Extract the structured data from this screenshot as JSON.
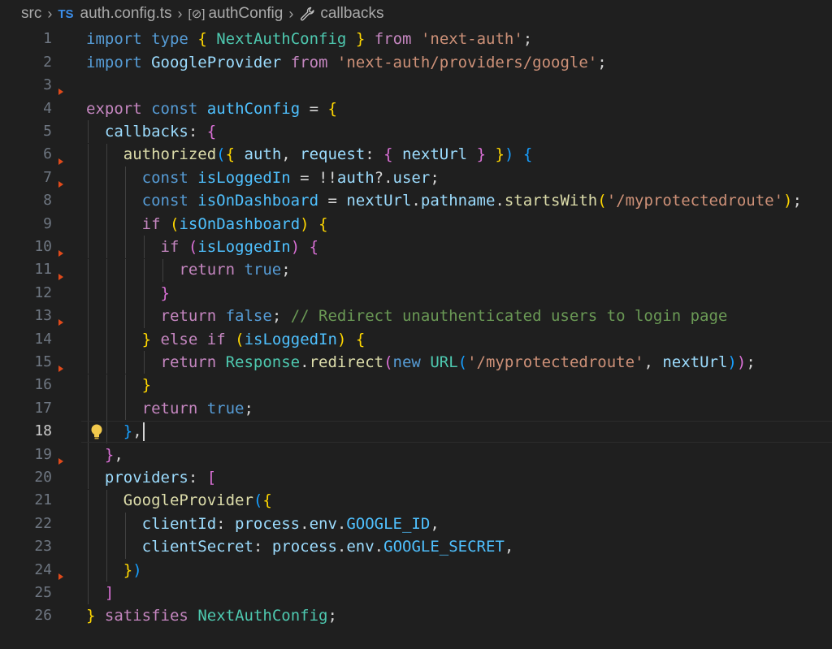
{
  "breadcrumb": {
    "folder": "src",
    "file_icon": "TS",
    "file": "auth.config.ts",
    "symbol_icon": "[⊘]",
    "symbol": "authConfig",
    "member": "callbacks"
  },
  "editor": {
    "language": "typescript",
    "current_line": 18,
    "line_numbers": [
      "1",
      "2",
      "3",
      "4",
      "5",
      "6",
      "7",
      "8",
      "9",
      "10",
      "11",
      "12",
      "13",
      "14",
      "15",
      "16",
      "17",
      "18",
      "19",
      "20",
      "21",
      "22",
      "23",
      "24",
      "25",
      "26"
    ],
    "lines": [
      [
        [
          "kw",
          "import"
        ],
        [
          "pl",
          " "
        ],
        [
          "kw",
          "type"
        ],
        [
          "pl",
          " "
        ],
        [
          "b1",
          "{"
        ],
        [
          "pl",
          " "
        ],
        [
          "type",
          "NextAuthConfig"
        ],
        [
          "pl",
          " "
        ],
        [
          "b1",
          "}"
        ],
        [
          "pl",
          " "
        ],
        [
          "ctl",
          "from"
        ],
        [
          "pl",
          " "
        ],
        [
          "str",
          "'next-auth'"
        ],
        [
          "pl",
          ";"
        ]
      ],
      [
        [
          "kw",
          "import"
        ],
        [
          "pl",
          " "
        ],
        [
          "var",
          "GoogleProvider"
        ],
        [
          "pl",
          " "
        ],
        [
          "ctl",
          "from"
        ],
        [
          "pl",
          " "
        ],
        [
          "str",
          "'next-auth/providers/google'"
        ],
        [
          "pl",
          ";"
        ]
      ],
      [],
      [
        [
          "ctl",
          "export"
        ],
        [
          "pl",
          " "
        ],
        [
          "kw",
          "const"
        ],
        [
          "pl",
          " "
        ],
        [
          "const",
          "authConfig"
        ],
        [
          "pl",
          " = "
        ],
        [
          "b1",
          "{"
        ]
      ],
      [
        [
          "pl",
          "  "
        ],
        [
          "var",
          "callbacks"
        ],
        [
          "pl",
          ": "
        ],
        [
          "b2",
          "{"
        ]
      ],
      [
        [
          "pl",
          "    "
        ],
        [
          "fn",
          "authorized"
        ],
        [
          "b3",
          "("
        ],
        [
          "b1",
          "{"
        ],
        [
          "pl",
          " "
        ],
        [
          "var",
          "auth"
        ],
        [
          "pl",
          ", "
        ],
        [
          "var",
          "request"
        ],
        [
          "pl",
          ": "
        ],
        [
          "b2",
          "{"
        ],
        [
          "pl",
          " "
        ],
        [
          "var",
          "nextUrl"
        ],
        [
          "pl",
          " "
        ],
        [
          "b2",
          "}"
        ],
        [
          "pl",
          " "
        ],
        [
          "b1",
          "}"
        ],
        [
          "b3",
          ")"
        ],
        [
          "pl",
          " "
        ],
        [
          "b3",
          "{"
        ]
      ],
      [
        [
          "pl",
          "      "
        ],
        [
          "kw",
          "const"
        ],
        [
          "pl",
          " "
        ],
        [
          "const",
          "isLoggedIn"
        ],
        [
          "pl",
          " = !!"
        ],
        [
          "var",
          "auth"
        ],
        [
          "pl",
          "?."
        ],
        [
          "var",
          "user"
        ],
        [
          "pl",
          ";"
        ]
      ],
      [
        [
          "pl",
          "      "
        ],
        [
          "kw",
          "const"
        ],
        [
          "pl",
          " "
        ],
        [
          "const",
          "isOnDashboard"
        ],
        [
          "pl",
          " = "
        ],
        [
          "var",
          "nextUrl"
        ],
        [
          "pl",
          "."
        ],
        [
          "var",
          "pathname"
        ],
        [
          "pl",
          "."
        ],
        [
          "fn",
          "startsWith"
        ],
        [
          "b1",
          "("
        ],
        [
          "str",
          "'/myprotectedroute'"
        ],
        [
          "b1",
          ")"
        ],
        [
          "pl",
          ";"
        ]
      ],
      [
        [
          "pl",
          "      "
        ],
        [
          "ctl",
          "if"
        ],
        [
          "pl",
          " "
        ],
        [
          "b1",
          "("
        ],
        [
          "const",
          "isOnDashboard"
        ],
        [
          "b1",
          ")"
        ],
        [
          "pl",
          " "
        ],
        [
          "b1",
          "{"
        ]
      ],
      [
        [
          "pl",
          "        "
        ],
        [
          "ctl",
          "if"
        ],
        [
          "pl",
          " "
        ],
        [
          "b2",
          "("
        ],
        [
          "const",
          "isLoggedIn"
        ],
        [
          "b2",
          ")"
        ],
        [
          "pl",
          " "
        ],
        [
          "b2",
          "{"
        ]
      ],
      [
        [
          "pl",
          "          "
        ],
        [
          "ctl",
          "return"
        ],
        [
          "pl",
          " "
        ],
        [
          "bool",
          "true"
        ],
        [
          "pl",
          ";"
        ]
      ],
      [
        [
          "pl",
          "        "
        ],
        [
          "b2",
          "}"
        ]
      ],
      [
        [
          "pl",
          "        "
        ],
        [
          "ctl",
          "return"
        ],
        [
          "pl",
          " "
        ],
        [
          "bool",
          "false"
        ],
        [
          "pl",
          "; "
        ],
        [
          "cmt",
          "// Redirect unauthenticated users to login page"
        ]
      ],
      [
        [
          "pl",
          "      "
        ],
        [
          "b1",
          "}"
        ],
        [
          "pl",
          " "
        ],
        [
          "ctl",
          "else"
        ],
        [
          "pl",
          " "
        ],
        [
          "ctl",
          "if"
        ],
        [
          "pl",
          " "
        ],
        [
          "b1",
          "("
        ],
        [
          "const",
          "isLoggedIn"
        ],
        [
          "b1",
          ")"
        ],
        [
          "pl",
          " "
        ],
        [
          "b1",
          "{"
        ]
      ],
      [
        [
          "pl",
          "        "
        ],
        [
          "ctl",
          "return"
        ],
        [
          "pl",
          " "
        ],
        [
          "type",
          "Response"
        ],
        [
          "pl",
          "."
        ],
        [
          "fn",
          "redirect"
        ],
        [
          "b2",
          "("
        ],
        [
          "kw",
          "new"
        ],
        [
          "pl",
          " "
        ],
        [
          "type",
          "URL"
        ],
        [
          "b3",
          "("
        ],
        [
          "str",
          "'/myprotectedroute'"
        ],
        [
          "pl",
          ", "
        ],
        [
          "var",
          "nextUrl"
        ],
        [
          "b3",
          ")"
        ],
        [
          "b2",
          ")"
        ],
        [
          "pl",
          ";"
        ]
      ],
      [
        [
          "pl",
          "      "
        ],
        [
          "b1",
          "}"
        ]
      ],
      [
        [
          "pl",
          "      "
        ],
        [
          "ctl",
          "return"
        ],
        [
          "pl",
          " "
        ],
        [
          "bool",
          "true"
        ],
        [
          "pl",
          ";"
        ]
      ],
      [
        [
          "pl",
          "    "
        ],
        [
          "b3",
          "}"
        ],
        [
          "pl",
          ","
        ]
      ],
      [
        [
          "pl",
          "  "
        ],
        [
          "b2",
          "}"
        ],
        [
          "pl",
          ","
        ]
      ],
      [
        [
          "pl",
          "  "
        ],
        [
          "var",
          "providers"
        ],
        [
          "pl",
          ": "
        ],
        [
          "b2",
          "["
        ]
      ],
      [
        [
          "pl",
          "    "
        ],
        [
          "fn",
          "GoogleProvider"
        ],
        [
          "b3",
          "("
        ],
        [
          "b1",
          "{"
        ]
      ],
      [
        [
          "pl",
          "      "
        ],
        [
          "var",
          "clientId"
        ],
        [
          "pl",
          ": "
        ],
        [
          "var",
          "process"
        ],
        [
          "pl",
          "."
        ],
        [
          "var",
          "env"
        ],
        [
          "pl",
          "."
        ],
        [
          "const",
          "GOOGLE_ID"
        ],
        [
          "pl",
          ","
        ]
      ],
      [
        [
          "pl",
          "      "
        ],
        [
          "var",
          "clientSecret"
        ],
        [
          "pl",
          ": "
        ],
        [
          "var",
          "process"
        ],
        [
          "pl",
          "."
        ],
        [
          "var",
          "env"
        ],
        [
          "pl",
          "."
        ],
        [
          "const",
          "GOOGLE_SECRET"
        ],
        [
          "pl",
          ","
        ]
      ],
      [
        [
          "pl",
          "    "
        ],
        [
          "b1",
          "}"
        ],
        [
          "b3",
          ")"
        ]
      ],
      [
        [
          "pl",
          "  "
        ],
        [
          "b2",
          "]"
        ]
      ],
      [
        [
          "b1",
          "}"
        ],
        [
          "pl",
          " "
        ],
        [
          "ctl",
          "satisfies"
        ],
        [
          "pl",
          " "
        ],
        [
          "type",
          "NextAuthConfig"
        ],
        [
          "pl",
          ";"
        ]
      ]
    ],
    "fold_markers": [
      3,
      6,
      7,
      10,
      11,
      13,
      15,
      19,
      24
    ],
    "lightbulb_line": 18
  }
}
